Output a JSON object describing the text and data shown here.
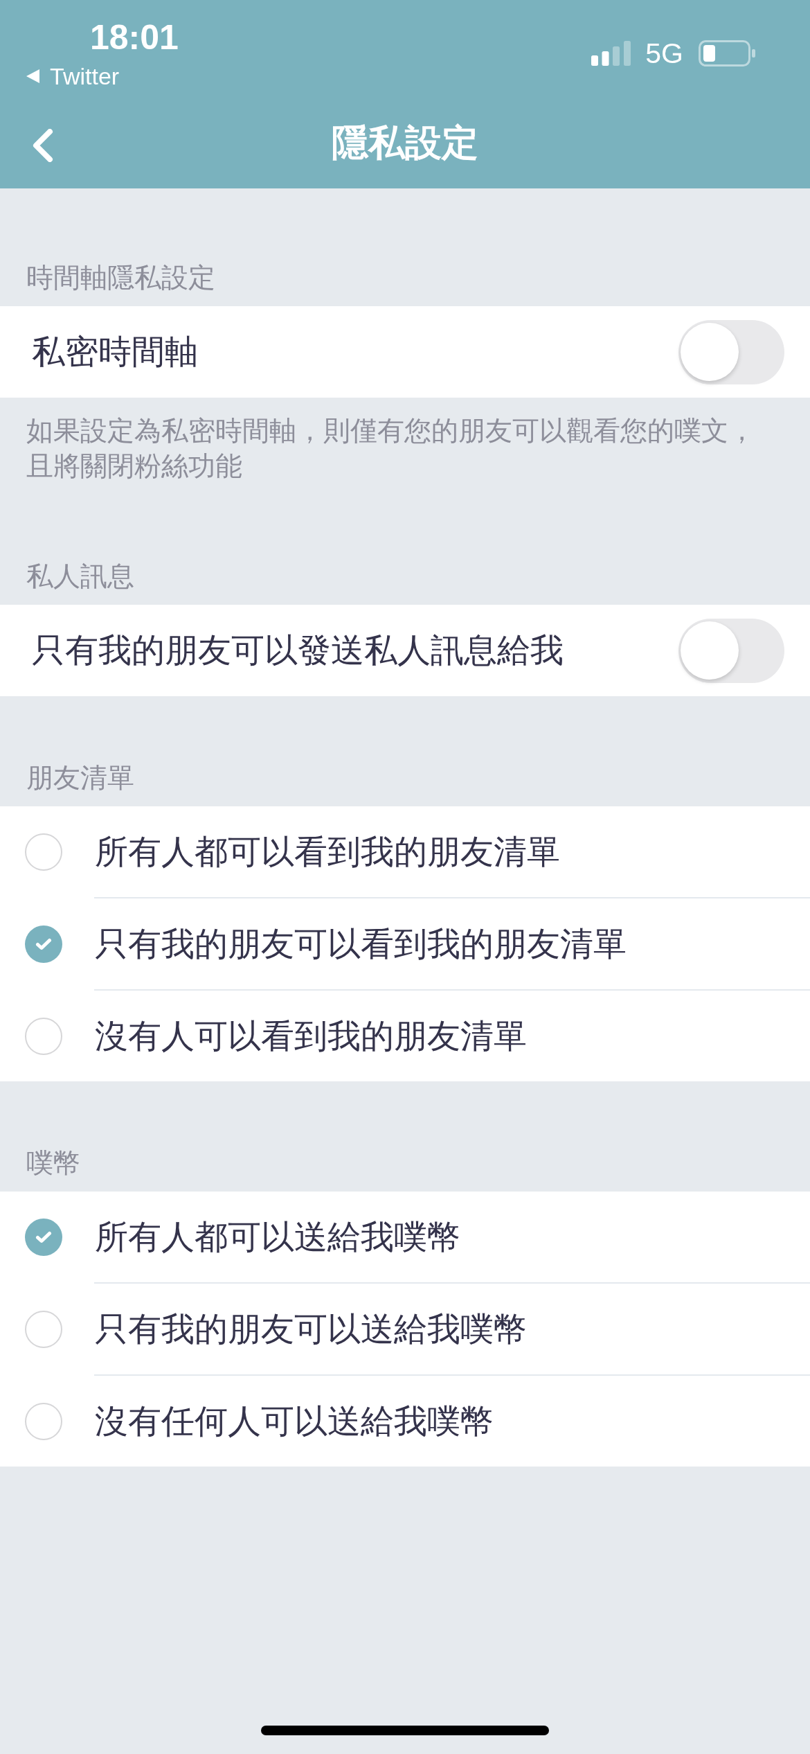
{
  "status_bar": {
    "time": "18:01",
    "back_to_app": "Twitter",
    "network": "5G"
  },
  "nav_bar": {
    "title": "隱私設定"
  },
  "sections": [
    {
      "title": "時間軸隱私設定",
      "items": [
        {
          "kind": "toggle",
          "label": "私密時間軸",
          "on": false
        }
      ],
      "description": "如果設定為私密時間軸，則僅有您的朋友可以觀看您的噗文，且將關閉粉絲功能"
    },
    {
      "title": "私人訊息",
      "items": [
        {
          "kind": "toggle",
          "label": "只有我的朋友可以發送私人訊息給我",
          "on": false
        }
      ]
    },
    {
      "title": "朋友清單",
      "items": [
        {
          "kind": "radio",
          "label": "所有人都可以看到我的朋友清單",
          "selected": false
        },
        {
          "kind": "radio",
          "label": "只有我的朋友可以看到我的朋友清單",
          "selected": true
        },
        {
          "kind": "radio",
          "label": "沒有人可以看到我的朋友清單",
          "selected": false
        }
      ]
    },
    {
      "title": "噗幣",
      "items": [
        {
          "kind": "radio",
          "label": "所有人都可以送給我噗幣",
          "selected": true
        },
        {
          "kind": "radio",
          "label": "只有我的朋友可以送給我噗幣",
          "selected": false
        },
        {
          "kind": "radio",
          "label": "沒有任何人可以送給我噗幣",
          "selected": false
        }
      ]
    }
  ]
}
